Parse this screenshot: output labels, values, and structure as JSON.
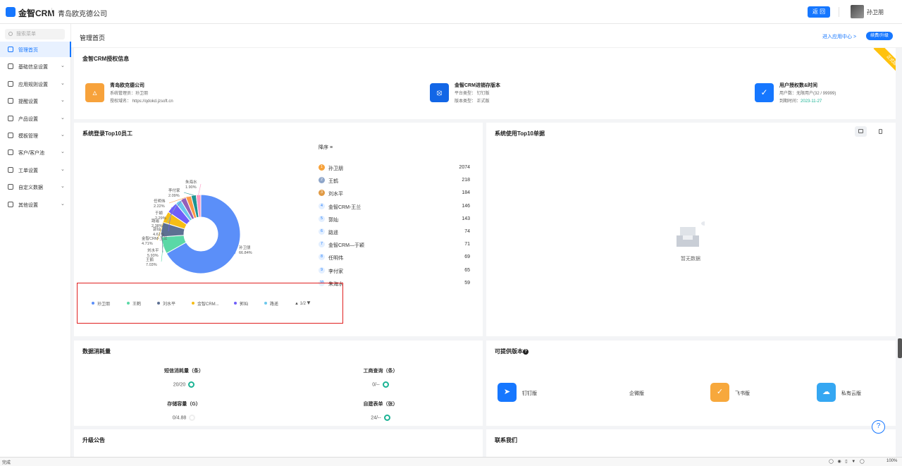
{
  "app": {
    "brand": "金智CRM",
    "company": "青岛欧克德公司",
    "back_label": "返 回",
    "user_name": "孙卫朋"
  },
  "sidebar": {
    "search_placeholder": "搜索菜单",
    "items": [
      {
        "label": "管理首页",
        "icon": "home-icon",
        "active": true
      },
      {
        "label": "基础信息设置",
        "icon": "cube-icon"
      },
      {
        "label": "应用规则设置",
        "icon": "doc-icon"
      },
      {
        "label": "提醒设置",
        "icon": "bell-icon"
      },
      {
        "label": "产品设置",
        "icon": "gear-icon"
      },
      {
        "label": "模板管理",
        "icon": "book-icon"
      },
      {
        "label": "客户/客户池",
        "icon": "users-icon"
      },
      {
        "label": "工单设置",
        "icon": "ticket-icon"
      },
      {
        "label": "自定义数据",
        "icon": "tools-icon"
      },
      {
        "label": "其他设置",
        "icon": "grid-icon"
      }
    ]
  },
  "header": {
    "title": "管理首页",
    "enter_center": "进入应用中心 >",
    "renew_label": "续费/升级"
  },
  "license": {
    "title": "金智CRM授权信息",
    "ribbon": "正式版",
    "company": {
      "name": "青岛欧克德公司",
      "line1": "系统管理员：孙卫朋",
      "line2": "授权域名： https://qdokd.jzsoft.cn"
    },
    "version": {
      "name": "金智CRM进销存版本",
      "line1": "平台类型： 钉钉版",
      "line2": "版本类型： 正式版"
    },
    "users": {
      "name": "用户授权数&时间",
      "line1": "用户数：无限用户(32 / 99999)",
      "line2_label": "到期时间：",
      "expiry": "2023-11-27"
    }
  },
  "top10_staff": {
    "title": "系统登录Top10员工",
    "sort_label": "降序",
    "pager": "1/2",
    "ranking": [
      {
        "rank": "1",
        "name": "孙卫朋",
        "value": "2074"
      },
      {
        "rank": "2",
        "name": "王鹤",
        "value": "218"
      },
      {
        "rank": "3",
        "name": "刘水平",
        "value": "184"
      },
      {
        "rank": "4",
        "name": "金智CRM-王兰",
        "value": "146"
      },
      {
        "rank": "5",
        "name": "郭灿",
        "value": "143"
      },
      {
        "rank": "6",
        "name": "路遥",
        "value": "74"
      },
      {
        "rank": "7",
        "name": "金智CRM—于颖",
        "value": "71"
      },
      {
        "rank": "8",
        "name": "任明伟",
        "value": "69"
      },
      {
        "rank": "9",
        "name": "李付家",
        "value": "65"
      },
      {
        "rank": "10",
        "name": "朱海水",
        "value": "59"
      }
    ],
    "legend": [
      "孙卫朋",
      "王鹤",
      "刘水平",
      "金智CRM...",
      "郭灿",
      "路遥"
    ]
  },
  "chart_data": {
    "type": "pie",
    "categories": [
      "孙卫朋",
      "王鹤",
      "刘水平",
      "金智CRM-王兰",
      "郭灿",
      "路遥",
      "金智CRM—于颖",
      "任明伟",
      "李付家",
      "朱海水"
    ],
    "values": [
      66.84,
      7.03,
      5.93,
      4.71,
      4.61,
      2.38,
      2.29,
      2.22,
      2.09,
      1.9
    ],
    "labels": [
      "孙卫朋 66.84%",
      "王鹤 7.03%",
      "刘水平 5.93%",
      "金智CRM-王兰 4.71%",
      "郭灿 4.61%",
      "路遥 2.38%",
      "于颖 2.29%",
      "任明伟 2.22%",
      "李付家 2.09%",
      "朱海水 1.90%"
    ],
    "colors": [
      "#5b8ff9",
      "#5ad8a6",
      "#5d7092",
      "#f6bd16",
      "#6f5ef9",
      "#6dc8ec",
      "#945fb9",
      "#ff9845",
      "#1e9493",
      "#ff99c3"
    ],
    "legend_position": "bottom"
  },
  "top10_forms": {
    "title": "系统使用Top10单据",
    "empty": "暂无数据"
  },
  "usage": {
    "title": "数据消耗量",
    "metrics": [
      {
        "label": "短信消耗量（条）",
        "value": "20/20"
      },
      {
        "label": "工商查询（条）",
        "value": "0/--"
      },
      {
        "label": "存储容量（G）",
        "value": "0/4.88"
      },
      {
        "label": "自建表单（张）",
        "value": "24/--"
      }
    ]
  },
  "editions": {
    "title": "可提供版本",
    "items": [
      {
        "label": "钉钉版",
        "color": "#1677ff"
      },
      {
        "label": "企微版",
        "color": "#ffffff"
      },
      {
        "label": "飞书版",
        "color": "#f7a83c"
      },
      {
        "label": "私有云版",
        "color": "#35a7f2"
      }
    ]
  },
  "notice": {
    "title": "升级公告"
  },
  "contact": {
    "title": "联系我们"
  },
  "status": {
    "left": "完成",
    "zoom": "100%"
  }
}
